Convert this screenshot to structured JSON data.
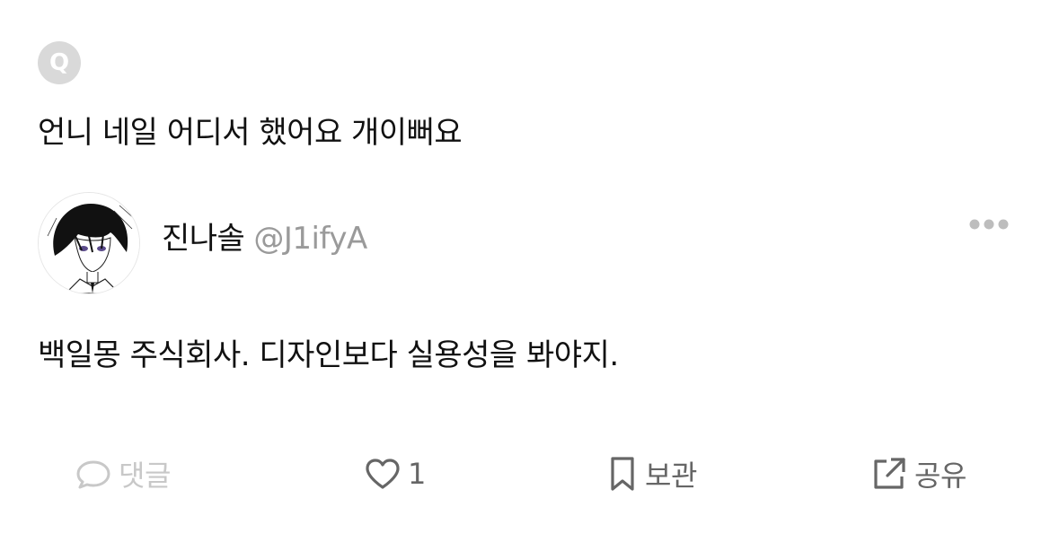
{
  "question": {
    "badge": "Q",
    "text": "언니 네일 어디서 했어요 개이뻐요"
  },
  "answer": {
    "author_name": "진나솔",
    "author_handle": "@J1ifyA",
    "text": "백일몽 주식회사. 디자인보다 실용성을 봐야지."
  },
  "actions": {
    "comment_label": "댓글",
    "like_count": "1",
    "save_label": "보관",
    "share_label": "공유"
  },
  "icons": {
    "more": "more-horizontal-icon",
    "comment": "speech-bubble-icon",
    "like": "heart-icon",
    "save": "bookmark-icon",
    "share": "share-external-icon"
  },
  "colors": {
    "text": "#111111",
    "muted": "#9a9a9a",
    "disabled": "#c8c8c8",
    "badge_bg": "#d9d9d9",
    "icon": "#666666"
  }
}
